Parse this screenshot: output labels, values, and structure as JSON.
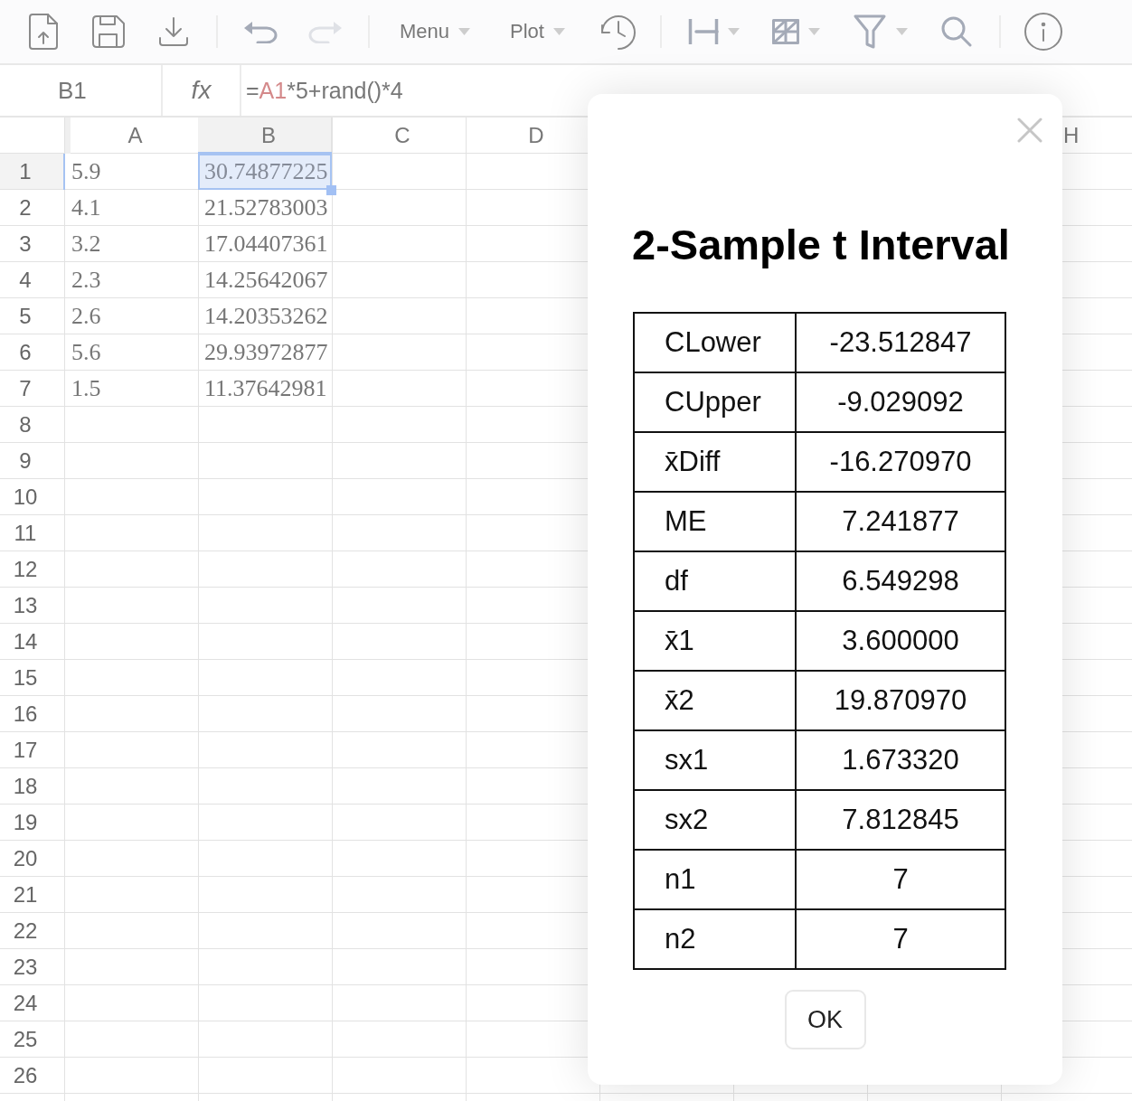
{
  "toolbar": {
    "groups": [
      {
        "items": [
          {
            "kind": "icon",
            "disabled": false
          },
          {
            "kind": "icon",
            "disabled": false
          },
          {
            "kind": "icon",
            "disabled": false
          }
        ]
      },
      {
        "items": [
          {
            "kind": "icon",
            "disabled": false
          },
          {
            "kind": "icon",
            "disabled": true
          }
        ]
      },
      {
        "items": [
          {
            "kind": "menu",
            "label": "Menu",
            "disabled": false
          },
          {
            "kind": "menu",
            "label": "Plot",
            "disabled": false
          },
          {
            "kind": "icon",
            "disabled": false
          }
        ]
      },
      {
        "items": [
          {
            "kind": "icon_menu",
            "disabled": false
          },
          {
            "kind": "icon_menu",
            "disabled": false
          },
          {
            "kind": "icon_menu",
            "disabled": false
          },
          {
            "kind": "icon",
            "disabled": false
          }
        ]
      },
      {
        "items": [
          {
            "kind": "icon",
            "disabled": false
          }
        ]
      }
    ]
  },
  "formula_bar": {
    "cell_name": "B1",
    "function_label": "fx",
    "formula": [
      {
        "text": "=",
        "kind": "text"
      },
      {
        "text": "A1",
        "kind": "reference"
      },
      {
        "text": "*5+rand()*4",
        "kind": "text"
      }
    ]
  },
  "sheet": {
    "columns": [
      {
        "label": "A",
        "selected": false
      },
      {
        "label": "B",
        "selected": true
      },
      {
        "label": "C",
        "selected": false
      },
      {
        "label": "D",
        "selected": false
      }
    ],
    "columns_beyond_dialog": [
      {
        "label": "H",
        "selected": false
      }
    ],
    "rows": [
      {
        "number": "1",
        "selected": true,
        "cells": [
          {
            "value": "5.9",
            "selected": false
          },
          {
            "value": "30.74877225",
            "selected": true
          }
        ]
      },
      {
        "number": "2",
        "selected": false,
        "cells": [
          {
            "value": "4.1",
            "selected": false
          },
          {
            "value": "21.52783003",
            "selected": false
          }
        ]
      },
      {
        "number": "3",
        "selected": false,
        "cells": [
          {
            "value": "3.2",
            "selected": false
          },
          {
            "value": "17.04407361",
            "selected": false
          }
        ]
      },
      {
        "number": "4",
        "selected": false,
        "cells": [
          {
            "value": "2.3",
            "selected": false
          },
          {
            "value": "14.25642067",
            "selected": false
          }
        ]
      },
      {
        "number": "5",
        "selected": false,
        "cells": [
          {
            "value": "2.6",
            "selected": false
          },
          {
            "value": "14.20353262",
            "selected": false
          }
        ]
      },
      {
        "number": "6",
        "selected": false,
        "cells": [
          {
            "value": "5.6",
            "selected": false
          },
          {
            "value": "29.93972877",
            "selected": false
          }
        ]
      },
      {
        "number": "7",
        "selected": false,
        "cells": [
          {
            "value": "1.5",
            "selected": false
          },
          {
            "value": "11.37642981",
            "selected": false
          }
        ]
      },
      {
        "number": "8",
        "selected": false
      },
      {
        "number": "9",
        "selected": false
      },
      {
        "number": "10",
        "selected": false
      },
      {
        "number": "11",
        "selected": false
      },
      {
        "number": "12",
        "selected": false
      },
      {
        "number": "13",
        "selected": false
      },
      {
        "number": "14",
        "selected": false
      },
      {
        "number": "15",
        "selected": false
      },
      {
        "number": "16",
        "selected": false
      },
      {
        "number": "17",
        "selected": false
      },
      {
        "number": "18",
        "selected": false
      },
      {
        "number": "19",
        "selected": false
      },
      {
        "number": "20",
        "selected": false
      },
      {
        "number": "21",
        "selected": false
      },
      {
        "number": "22",
        "selected": false
      },
      {
        "number": "23",
        "selected": false
      },
      {
        "number": "24",
        "selected": false
      },
      {
        "number": "25",
        "selected": false
      },
      {
        "number": "26",
        "selected": false
      }
    ]
  },
  "dialog": {
    "title": "2-Sample t Interval",
    "results": [
      {
        "label": "CLower",
        "value": "-23.512847"
      },
      {
        "label": "CUpper",
        "value": "-9.029092"
      },
      {
        "label": "x̄Diff",
        "value": "-16.270970"
      },
      {
        "label": "ME",
        "value": "7.241877"
      },
      {
        "label": "df",
        "value": "6.549298"
      },
      {
        "label": "x̄1",
        "value": "3.600000"
      },
      {
        "label": "x̄2",
        "value": "19.870970"
      },
      {
        "label": "sx1",
        "value": "1.673320"
      },
      {
        "label": "sx2",
        "value": "7.812845"
      },
      {
        "label": "n1",
        "value": "7"
      },
      {
        "label": "n2",
        "value": "7"
      }
    ],
    "ok_button": "OK"
  }
}
